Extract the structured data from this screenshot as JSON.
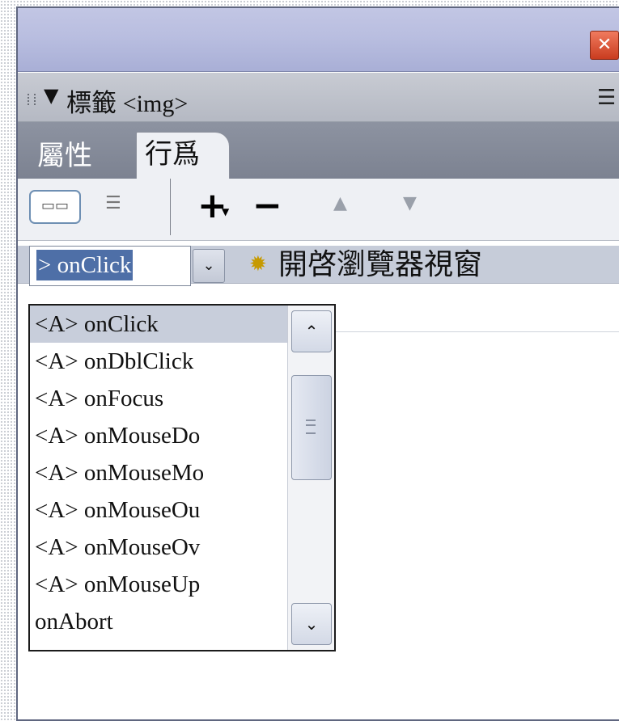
{
  "titlebar": {
    "close_glyph": "✕"
  },
  "panel": {
    "collapse_glyph": "▼",
    "title": "標籤",
    "tag_name": "<img>",
    "options_icon": "options-menu-icon"
  },
  "tabs": [
    {
      "label": "屬性",
      "active": false
    },
    {
      "label": "行爲",
      "active": true
    }
  ],
  "toolbar": {
    "show_set_events_icon": "show-set-events-icon",
    "show_all_events_icon": "show-all-events-icon",
    "add_label": "+",
    "remove_label": "−",
    "up_glyph": "▲",
    "down_glyph": "▼"
  },
  "behavior_row": {
    "event_value": "> onClick",
    "arrow_glyph": "⌄",
    "action_icon": "gear-icon",
    "action_label": "開啓瀏覽器視窗"
  },
  "event_list": {
    "items": [
      "<A> onClick",
      "<A> onDblClick",
      "<A> onFocus",
      "<A> onMouseDo",
      "<A> onMouseMo",
      "<A> onMouseOu",
      "<A> onMouseOv",
      "<A> onMouseUp",
      "onAbort"
    ],
    "selected_index": 0
  },
  "colors": {
    "selection_bg": "#4e6fa7",
    "titlebar": "#b9bee0",
    "tab_bar": "#858b99",
    "close_button": "#d9502e"
  }
}
